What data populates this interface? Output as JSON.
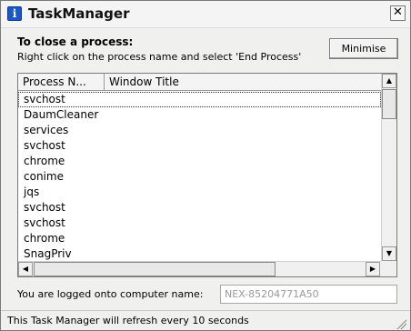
{
  "window": {
    "title": "TaskManager",
    "icon": "info-icon",
    "icon_glyph": "i",
    "close_glyph": "✕"
  },
  "instructions": {
    "heading": "To close a process:",
    "body": "Right click on the process name and select 'End Process'"
  },
  "toolbar": {
    "minimise_label": "Minimise"
  },
  "process_list": {
    "columns": [
      "Process N...",
      "Window Title"
    ],
    "rows": [
      {
        "process": "svchost",
        "window_title": ""
      },
      {
        "process": "DaumCleaner",
        "window_title": ""
      },
      {
        "process": "services",
        "window_title": ""
      },
      {
        "process": "svchost",
        "window_title": ""
      },
      {
        "process": "chrome",
        "window_title": ""
      },
      {
        "process": "conime",
        "window_title": ""
      },
      {
        "process": "jqs",
        "window_title": ""
      },
      {
        "process": "svchost",
        "window_title": ""
      },
      {
        "process": "svchost",
        "window_title": ""
      },
      {
        "process": "chrome",
        "window_title": ""
      },
      {
        "process": "SnagPriv",
        "window_title": ""
      }
    ]
  },
  "computer": {
    "label": "You are logged onto computer name:",
    "name": "NEX-85204771A50"
  },
  "status": {
    "text": "This Task Manager will refresh every 10 seconds"
  },
  "colors": {
    "window_bg": "#f0f0ee",
    "list_bg": "#ffffff",
    "disabled_text": "#9a9a9a",
    "icon_blue": "#1b57c9"
  }
}
